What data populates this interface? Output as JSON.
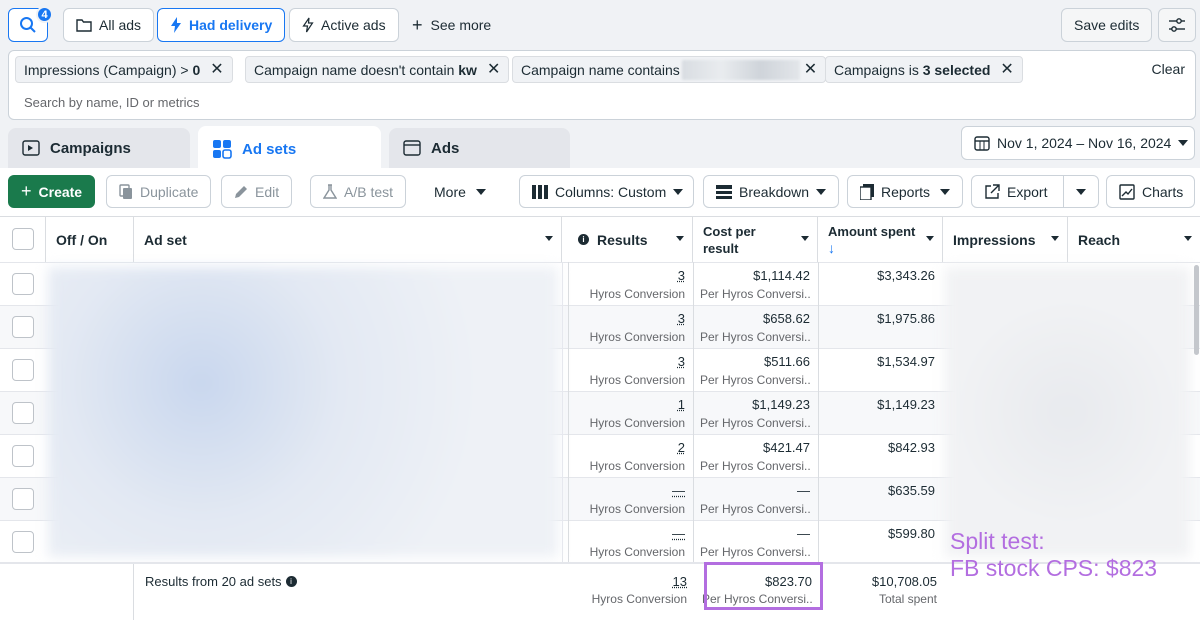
{
  "topbar": {
    "search_badge": "4",
    "all_ads": "All ads",
    "had_delivery": "Had delivery",
    "active_ads": "Active ads",
    "see_more": "See more",
    "save_edits": "Save edits"
  },
  "filters": {
    "chips": [
      {
        "text": "Impressions (Campaign) > ",
        "bold": "0"
      },
      {
        "text": "Campaign name doesn't contain ",
        "bold": "kw"
      },
      {
        "text": "Campaign name contains",
        "bold": ""
      },
      {
        "text": "Campaigns is ",
        "bold": "3 selected"
      }
    ],
    "clear": "Clear",
    "search_placeholder": "Search by name, ID or metrics"
  },
  "tabs": {
    "campaigns": "Campaigns",
    "ad_sets": "Ad sets",
    "ads": "Ads"
  },
  "date_range": "Nov 1, 2024 – Nov 16, 2024",
  "toolbar": {
    "create": "Create",
    "duplicate": "Duplicate",
    "edit": "Edit",
    "ab_test": "A/B test",
    "more": "More",
    "columns": "Columns: Custom",
    "breakdown": "Breakdown",
    "reports": "Reports",
    "export": "Export",
    "charts": "Charts"
  },
  "table": {
    "headers": {
      "off_on": "Off / On",
      "ad_set": "Ad set",
      "results": "Results",
      "cost_per_result_1": "Cost per",
      "cost_per_result_2": "result",
      "amount_spent": "Amount spent",
      "sort_arrow": "↓",
      "impressions": "Impressions",
      "reach": "Reach"
    },
    "rows": [
      {
        "results": "3",
        "results_sub": "Hyros Conversion",
        "cost": "$1,114.42",
        "cost_sub": "Per Hyros Conversi...",
        "spent": "$3,343.26"
      },
      {
        "results": "3",
        "results_sub": "Hyros Conversion",
        "cost": "$658.62",
        "cost_sub": "Per Hyros Conversi...",
        "spent": "$1,975.86"
      },
      {
        "results": "3",
        "results_sub": "Hyros Conversion",
        "cost": "$511.66",
        "cost_sub": "Per Hyros Conversi...",
        "spent": "$1,534.97"
      },
      {
        "results": "1",
        "results_sub": "Hyros Conversion",
        "cost": "$1,149.23",
        "cost_sub": "Per Hyros Conversi...",
        "spent": "$1,149.23"
      },
      {
        "results": "2",
        "results_sub": "Hyros Conversion",
        "cost": "$421.47",
        "cost_sub": "Per Hyros Conversi...",
        "spent": "$842.93"
      },
      {
        "results": "—",
        "results_sub": "Hyros Conversion",
        "cost": "—",
        "cost_sub": "Per Hyros Conversi...",
        "spent": "$635.59"
      },
      {
        "results": "—",
        "results_sub": "Hyros Conversion",
        "cost": "—",
        "cost_sub": "Per Hyros Conversi...",
        "spent": "$599.80"
      }
    ],
    "summary": {
      "label": "Results from 20 ad sets",
      "results": "13",
      "results_sub": "Hyros Conversion",
      "cost": "$823.70",
      "cost_sub": "Per Hyros Conversi...",
      "spent": "$10,708.05",
      "spent_sub": "Total spent"
    }
  },
  "annotation": {
    "line1": "Split test:",
    "line2": "FB stock CPS: $823"
  },
  "colors": {
    "primary_blue": "#1877f2",
    "create_green": "#1a7a4c",
    "annotation_purple": "#b36ee0"
  }
}
